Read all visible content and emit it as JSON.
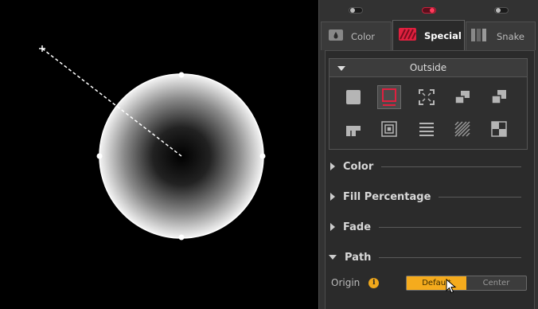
{
  "toggles": [
    {
      "state": "off"
    },
    {
      "state": "on"
    },
    {
      "state": "off"
    }
  ],
  "tabs": [
    {
      "label": "Color",
      "icon": "color-drop-icon",
      "active": false
    },
    {
      "label": "Special",
      "icon": "special-stripes-icon",
      "active": true
    },
    {
      "label": "Snake",
      "icon": "snake-bars-icon",
      "active": false
    }
  ],
  "outside": {
    "title": "Outside",
    "styles": [
      "square-fill-icon",
      "square-outline-icon",
      "corners-icon",
      "stacked-squares-icon",
      "offset-squares-icon",
      "steps-icon",
      "concentric-squares-icon",
      "lines-icon",
      "diagonal-hatch-icon",
      "checker-icon"
    ],
    "selected": "square-outline-icon"
  },
  "sections": {
    "color": "Color",
    "fill_percentage": "Fill Percentage",
    "fade": "Fade",
    "path": "Path"
  },
  "path": {
    "origin_label": "Origin",
    "info": "i",
    "options": [
      "Default",
      "Center"
    ],
    "selected": "Default"
  },
  "colors": {
    "accent_red": "#e0203f",
    "accent_orange": "#f5ab1d"
  }
}
